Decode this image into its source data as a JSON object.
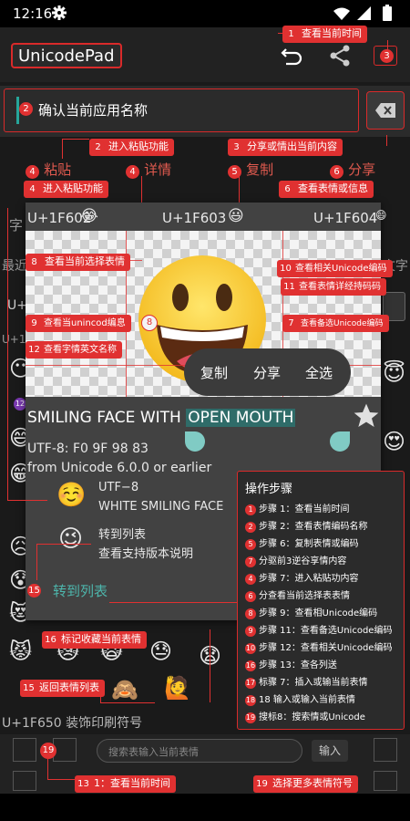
{
  "status": {
    "time": "12:16"
  },
  "app": {
    "title": "UnicodePad"
  },
  "input": {
    "text": "确认当前应用名称"
  },
  "tabs": {
    "paste": "粘贴",
    "detail": "详情",
    "copy": "复制",
    "share": "分享"
  },
  "popup": {
    "codes": [
      "U+1F602",
      "U+1F603",
      "U+1F604"
    ],
    "char_name_plain": "SMILING FACE WITH ",
    "char_name_selected": "OPEN MOUTH",
    "utf8": "UTF-8: F0 9F 98 83",
    "from": "from Unicode 6.0.0 or earlier",
    "related_1_line1": "UTF−8",
    "related_1_line2": "WHITE SMILING FACE",
    "related_2_line1": "转到列表",
    "related_2_line2": "查看支持版本说明",
    "goto_list": "转到列表",
    "context": {
      "copy": "复制",
      "share": "分享",
      "selectall": "全选"
    }
  },
  "background": {
    "left_char": "字",
    "left_recent": "最近",
    "right_text": "文字",
    "u_prefix": "U+",
    "u_prefix2": "U+1",
    "row12": "12",
    "section_title": "U+1F650 装饰印刷符号"
  },
  "search": {
    "placeholder": "搜索表输入当前表情",
    "button": "输入"
  },
  "annotations": {
    "a1": "查看当前时间",
    "a2": "确认当前应用名称",
    "a3": "3",
    "b2": "进入粘贴功能",
    "b3": "分享或情出当前内容",
    "c4": "进入粘贴功能",
    "c6": "查看表情或信息",
    "d8": "查看当前选择表情",
    "d10": "查看相关Unicode编码",
    "d11": "查看表情详经持码码",
    "d9": "查看当unincod编息",
    "d7": "查看备选Unicode编码",
    "d12": "查看字情英文名称",
    "e8": "8",
    "f15": "15",
    "f16": "标记收藏当前表情",
    "f15b": "返回表情列表",
    "g19": "19",
    "g13": "1：查看当前时间",
    "g19b": "选择更多表情符号"
  },
  "steps": {
    "title": "操作步骤",
    "items": [
      {
        "n": "1",
        "t": "步骤 1：查看当前时间"
      },
      {
        "n": "2",
        "t": "步骤 2：查看表情编码名称"
      },
      {
        "n": "5",
        "t": "步骤 6：复制表情或编码"
      },
      {
        "n": "7",
        "t": "分驱前3逆谷享情内容"
      },
      {
        "n": "4",
        "t": "步骤 7：进入粘贴功内容"
      },
      {
        "n": "6",
        "t": "分查看当前选择表表情"
      },
      {
        "n": "8",
        "t": "步骤 9：查看相Unicode编码"
      },
      {
        "n": "9",
        "t": "步骤 11：查看备选Unicode编码"
      },
      {
        "n": "10",
        "t": "步骤 12：查看相关Unicode编码"
      },
      {
        "n": "16",
        "t": "步骤 13：查各列送"
      },
      {
        "n": "17",
        "t": "标骤 7：插入或输当前表情"
      },
      {
        "n": "18",
        "t": "18 输入或输入当前表情"
      },
      {
        "n": "19",
        "t": "搜标8：搜索情或Unicode"
      }
    ]
  }
}
